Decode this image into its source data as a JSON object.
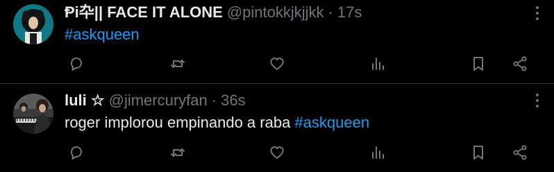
{
  "tweets": [
    {
      "display_name": "Ᵽi卆|| FACE IT ALONE",
      "handle": "@pintokkjkjjkk",
      "separator": "·",
      "time": "17s",
      "text_before": "",
      "hashtag": "#askqueen",
      "avatar_icon": "curly-hair-avatar-icon"
    },
    {
      "display_name": "luli ☆",
      "handle": "@jimercuryfan",
      "separator": "·",
      "time": "36s",
      "text_before": "roger implorou empinando a raba ",
      "hashtag": "#askqueen",
      "avatar_icon": "piano-photo-avatar-icon"
    }
  ],
  "actions": [
    "reply-icon",
    "retweet-icon",
    "like-icon",
    "views-icon",
    "bookmark-icon",
    "share-icon"
  ],
  "colors": {
    "background": "#000000",
    "text": "#e7e9ea",
    "muted": "#71767b",
    "link": "#1d9bf0",
    "divider": "#2f3336"
  }
}
